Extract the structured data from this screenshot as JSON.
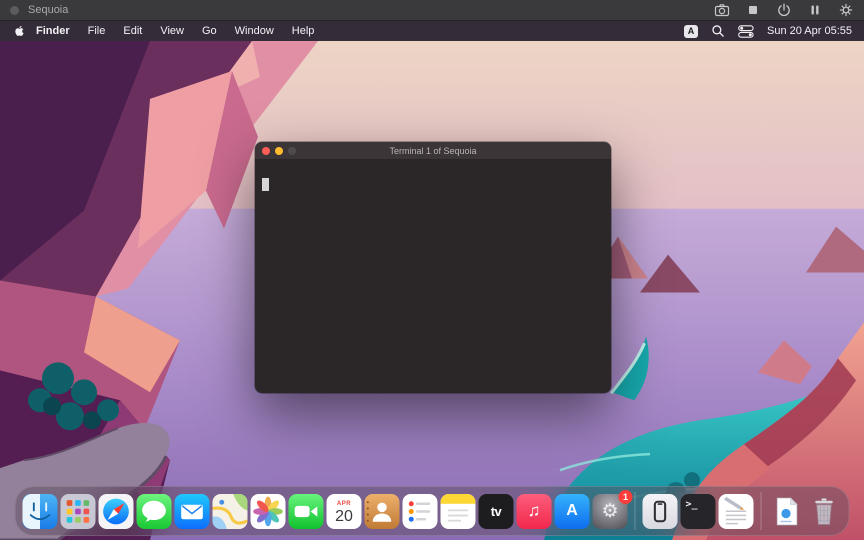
{
  "vm": {
    "title": "Sequoia",
    "toolbar_icons": [
      "camera-icon",
      "stop-icon",
      "power-icon",
      "pause-icon",
      "gear-icon"
    ]
  },
  "menubar": {
    "apple_icon": "apple-logo",
    "items": [
      "Finder",
      "File",
      "Edit",
      "View",
      "Go",
      "Window",
      "Help"
    ],
    "status_icons": [
      "input-source-icon",
      "search-icon",
      "control-center-icon"
    ],
    "input_source": "A",
    "clock": "Sun 20 Apr 05:55"
  },
  "terminal_window": {
    "title": "Terminal 1 of Sequoia",
    "traffic_lights": [
      "close",
      "minimize",
      "zoom-disabled"
    ]
  },
  "dock": {
    "items": [
      {
        "name": "finder-icon",
        "label": "Finder"
      },
      {
        "name": "launchpad-icon",
        "label": "Launchpad"
      },
      {
        "name": "safari-icon",
        "label": "Safari"
      },
      {
        "name": "messages-icon",
        "label": "Messages"
      },
      {
        "name": "mail-icon",
        "label": "Mail"
      },
      {
        "name": "maps-icon",
        "label": "Maps"
      },
      {
        "name": "photos-icon",
        "label": "Photos"
      },
      {
        "name": "facetime-icon",
        "label": "FaceTime"
      },
      {
        "name": "calendar-icon",
        "label": "Calendar"
      },
      {
        "name": "contacts-icon",
        "label": "Contacts"
      },
      {
        "name": "reminders-icon",
        "label": "Reminders"
      },
      {
        "name": "notes-icon",
        "label": "Notes"
      },
      {
        "name": "tv-icon",
        "label": "TV"
      },
      {
        "name": "music-icon",
        "label": "Music"
      },
      {
        "name": "app-store-icon",
        "label": "App Store"
      },
      {
        "name": "system-settings-icon",
        "label": "System Settings"
      },
      {
        "name": "iphone-mirroring-icon",
        "label": "iPhone Mirroring"
      },
      {
        "name": "terminal-icon",
        "label": "Terminal"
      },
      {
        "name": "textedit-icon",
        "label": "TextEdit"
      },
      {
        "name": "document-icon",
        "label": "Document"
      },
      {
        "name": "trash-icon",
        "label": "Trash"
      }
    ],
    "calendar": {
      "month": "APR",
      "day": "20"
    },
    "tv_label": "tv",
    "music_glyph": "♫",
    "app_store_letter": "A",
    "settings_gear_glyph": "⚙",
    "settings_badge": "1",
    "terminal_glyph": ">_"
  },
  "colors": {
    "accent_red_badge": "#fc3d39",
    "traffic_red": "#ff5f57",
    "traffic_yellow": "#febc2e",
    "terminal_bg": "#2b2627",
    "menubar_bg": "#1e1a20",
    "vm_bar_bg": "#3a3a3c"
  }
}
